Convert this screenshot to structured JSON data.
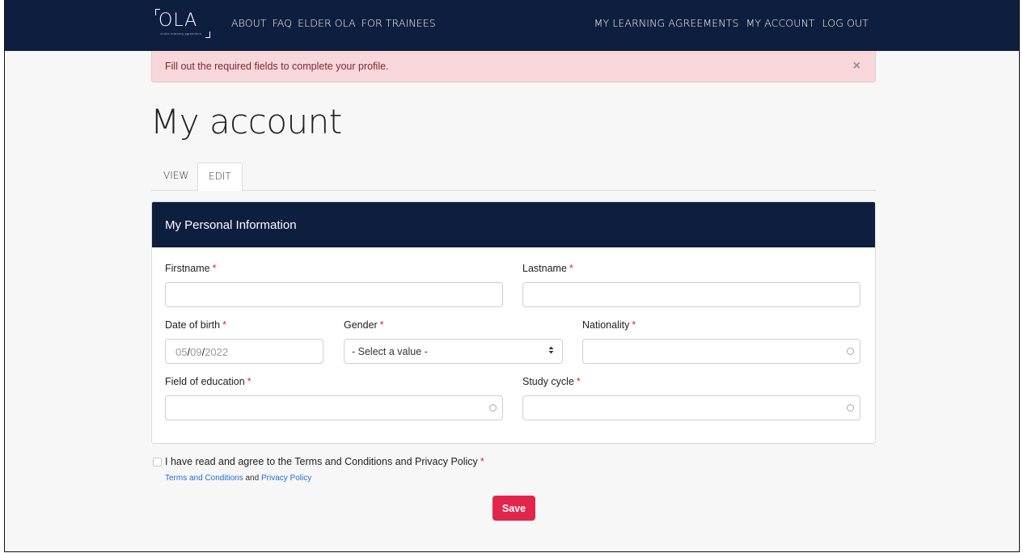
{
  "nav": {
    "logo_text": "OLA",
    "logo_subtext": "online learning agreement",
    "left_links": [
      "ABOUT",
      "FAQ",
      "ELDER OLA",
      "FOR TRAINEES"
    ],
    "right_links": [
      "MY LEARNING AGREEMENTS",
      "MY ACCOUNT",
      "LOG OUT"
    ]
  },
  "alert": {
    "message": "Fill out the required fields to complete your profile.",
    "close": "×"
  },
  "page": {
    "title": "My account"
  },
  "tabs": [
    {
      "label": "VIEW",
      "active": false
    },
    {
      "label": "EDIT",
      "active": true
    }
  ],
  "panel": {
    "title": "My Personal Information"
  },
  "form": {
    "required_mark": "*",
    "firstname_label": "Firstname",
    "lastname_label": "Lastname",
    "dob_label": "Date of birth",
    "dob_month": "05",
    "dob_sep": "/",
    "dob_day": "09",
    "dob_year": "2022",
    "gender_label": "Gender",
    "gender_value": "- Select a value -",
    "nationality_label": "Nationality",
    "field_of_education_label": "Field of education",
    "study_cycle_label": "Study cycle"
  },
  "terms": {
    "label": "I have read and agree to the Terms and Conditions and Privacy Policy",
    "link_terms": "Terms and Conditions",
    "and": "and",
    "link_privacy": "Privacy Policy"
  },
  "actions": {
    "save": "Save"
  },
  "colors": {
    "navy": "#0e1e3e",
    "alert_bg": "#f8d7da",
    "required": "#e0233f",
    "save_button": "#e2254c",
    "link": "#1f6fd1"
  }
}
